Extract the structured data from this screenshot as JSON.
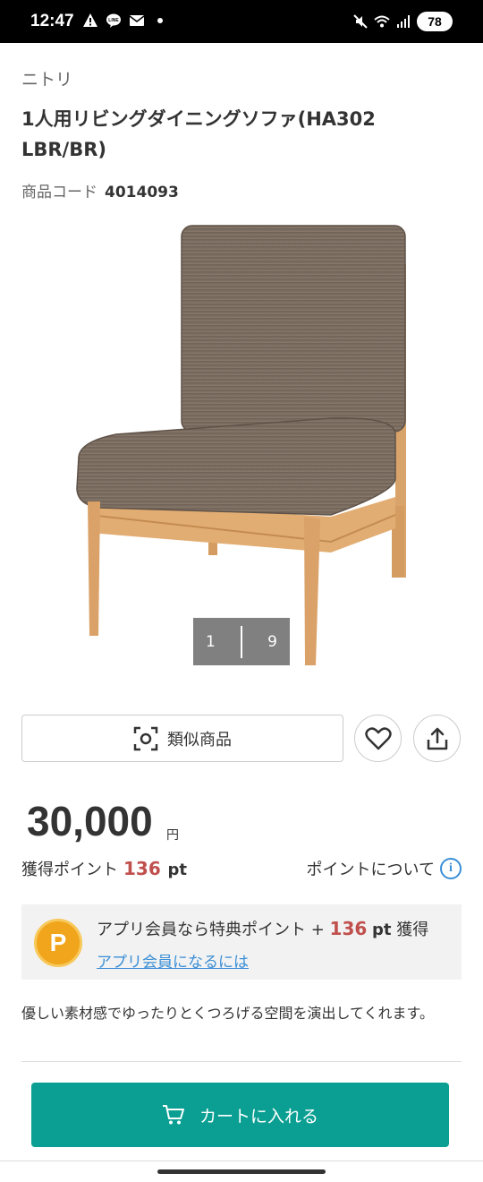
{
  "status_bar": {
    "time": "12:47",
    "battery": "78",
    "left_icons": [
      "warning-icon",
      "line-app-icon",
      "mail-icon",
      "dot"
    ],
    "right_icons": [
      "mute-icon",
      "wifi-icon",
      "signal-icon"
    ]
  },
  "product": {
    "brand": "ニトリ",
    "title": "1人用リビングダイニングソファ(HA302 LBR/BR)",
    "code_label": "商品コード",
    "code_value": "4014093",
    "image_pager": {
      "current": "1",
      "total": "9"
    }
  },
  "actions": {
    "similar_label": "類似商品",
    "favorite_icon": "heart-icon",
    "share_icon": "share-icon"
  },
  "price": {
    "amount": "30,000",
    "currency": "円",
    "points_label": "獲得ポイント",
    "points_value": "136",
    "points_unit": "pt",
    "points_about": "ポイントについて"
  },
  "app_member": {
    "coin_letter": "P",
    "text_prefix": "アプリ会員なら特典ポイント +",
    "points_value": "136",
    "points_unit": "pt",
    "text_suffix": "獲得",
    "link": "アプリ会員になるには"
  },
  "description": "優しい素材感でゆったりとくつろげる空間を演出してくれます。",
  "cart": {
    "label": "カートに入れる"
  },
  "colors": {
    "accent": "#0a9f92",
    "points": "#c0504d",
    "link": "#3a8fd6",
    "coin": "#f0a51c"
  }
}
